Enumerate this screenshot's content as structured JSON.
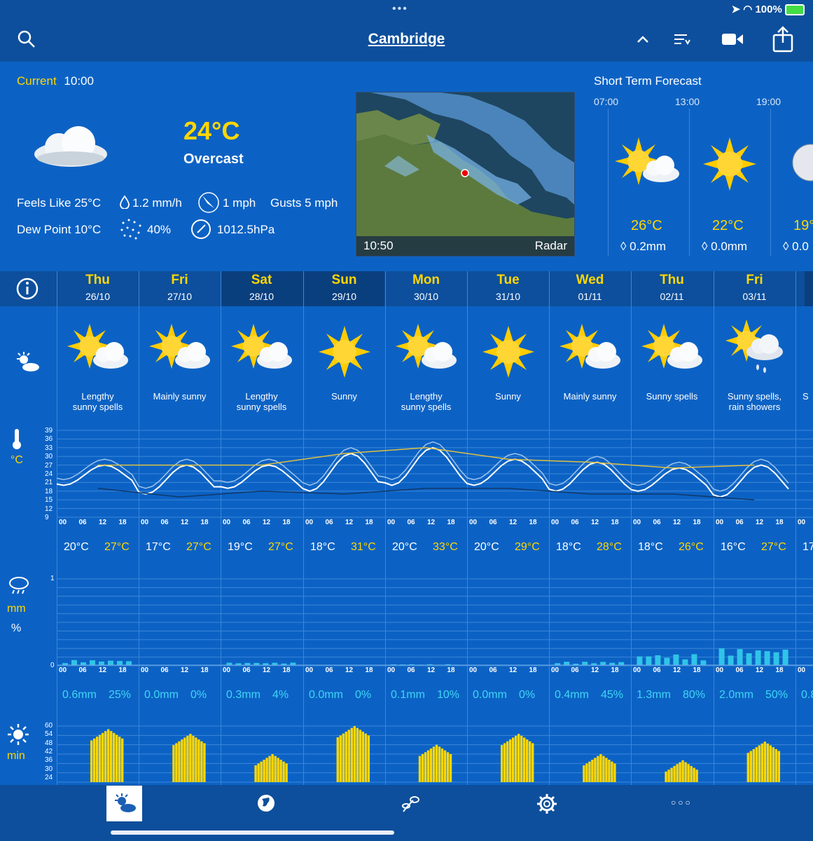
{
  "status": {
    "top_dots": "•••",
    "battery": "100%"
  },
  "header": {
    "title": "Cambridge"
  },
  "current": {
    "label": "Current",
    "time": "10:00",
    "temperature": "24°C",
    "condition": "Overcast",
    "feels_like": "Feels Like 25°C",
    "precip_rate": "1.2 mm/h",
    "wind": "1 mph",
    "gusts": "Gusts 5 mph",
    "dew_point": "Dew Point 10°C",
    "humidity": "40%",
    "pressure": "1012.5hPa"
  },
  "radar": {
    "time": "10:50",
    "label": "Radar"
  },
  "short_term": {
    "title": "Short Term Forecast",
    "slots": [
      {
        "time": "07:00",
        "icon": "sun-cloud-icon",
        "temp": "26°C",
        "rain": "0.2mm"
      },
      {
        "time": "13:00",
        "icon": "sun-icon",
        "temp": "22°C",
        "rain": "0.0mm"
      },
      {
        "time": "19:00",
        "icon": "moon-icon",
        "temp": "19°",
        "rain": "0.0"
      }
    ]
  },
  "days": [
    {
      "name": "Thu",
      "date": "26/10",
      "desc1": "Lengthy",
      "desc2": "sunny spells",
      "icon": "sun-cloud-icon",
      "tmin": "20°C",
      "tmax": "27°C",
      "rain": "0.6mm",
      "prob": "25%",
      "sun": 58
    },
    {
      "name": "Fri",
      "date": "27/10",
      "desc1": "Mainly sunny",
      "desc2": "",
      "icon": "sun-cloud-icon",
      "tmin": "17°C",
      "tmax": "27°C",
      "rain": "0.0mm",
      "prob": "0%",
      "sun": 55
    },
    {
      "name": "Sat",
      "date": "28/10",
      "desc1": "Lengthy",
      "desc2": "sunny spells",
      "icon": "sun-cloud-icon",
      "tmin": "19°C",
      "tmax": "27°C",
      "rain": "0.3mm",
      "prob": "4%",
      "sun": 42
    },
    {
      "name": "Sun",
      "date": "29/10",
      "desc1": "Sunny",
      "desc2": "",
      "icon": "sun-icon",
      "tmin": "18°C",
      "tmax": "31°C",
      "rain": "0.0mm",
      "prob": "0%",
      "sun": 60
    },
    {
      "name": "Mon",
      "date": "30/10",
      "desc1": "Lengthy",
      "desc2": "sunny spells",
      "icon": "sun-cloud-icon",
      "tmin": "20°C",
      "tmax": "33°C",
      "rain": "0.1mm",
      "prob": "10%",
      "sun": 48
    },
    {
      "name": "Tue",
      "date": "31/10",
      "desc1": "Sunny",
      "desc2": "",
      "icon": "sun-icon",
      "tmin": "20°C",
      "tmax": "29°C",
      "rain": "0.0mm",
      "prob": "0%",
      "sun": 55
    },
    {
      "name": "Wed",
      "date": "01/11",
      "desc1": "Mainly sunny",
      "desc2": "",
      "icon": "sun-cloud-icon",
      "tmin": "18°C",
      "tmax": "28°C",
      "rain": "0.4mm",
      "prob": "45%",
      "sun": 42
    },
    {
      "name": "Thu",
      "date": "02/11",
      "desc1": "Sunny spells",
      "desc2": "",
      "icon": "sun-cloud-icon",
      "tmin": "18°C",
      "tmax": "26°C",
      "rain": "1.3mm",
      "prob": "80%",
      "sun": 38
    },
    {
      "name": "Fri",
      "date": "03/11",
      "desc1": "Sunny spells,",
      "desc2": "rain showers",
      "icon": "sun-rain-icon",
      "tmin": "16°C",
      "tmax": "27°C",
      "rain": "2.0mm",
      "prob": "50%",
      "sun": 50
    }
  ],
  "partial_day": {
    "tmin": "17",
    "rain": "0.8",
    "desc": "S"
  },
  "axes": {
    "temp_unit": "°C",
    "temp_ticks": [
      "39",
      "36",
      "33",
      "30",
      "27",
      "24",
      "21",
      "18",
      "15",
      "12",
      "9"
    ],
    "hours": [
      "00",
      "06",
      "12",
      "18"
    ],
    "rain_unit_mm": "mm",
    "rain_unit_pct": "%",
    "rain_ticks": [
      "1",
      "0"
    ],
    "sun_unit": "min",
    "sun_ticks": [
      "60",
      "54",
      "48",
      "42",
      "36",
      "30",
      "24"
    ]
  },
  "colors": {
    "background": "#0c62c4",
    "header": "#0d4f9c",
    "accent": "#ffd700",
    "rain": "#3fd6f5"
  },
  "nav": [
    "weather-icon",
    "globe-icon",
    "plant-icon",
    "settings-icon",
    "more-icon"
  ],
  "chart_data": [
    {
      "type": "line",
      "title": "",
      "ylabel": "°C",
      "ylim": [
        9,
        39
      ],
      "x": [
        "26/10",
        "27/10",
        "28/10",
        "29/10",
        "30/10",
        "31/10",
        "01/11",
        "02/11",
        "03/11"
      ],
      "series": [
        {
          "values_min": [
            20,
            17,
            19,
            18,
            20,
            20,
            18,
            18,
            16
          ],
          "values_max": [
            27,
            27,
            27,
            31,
            33,
            29,
            28,
            26,
            27
          ]
        }
      ]
    },
    {
      "type": "bar",
      "title": "",
      "ylabel": "min",
      "ylim": [
        24,
        60
      ],
      "categories": [
        "26/10",
        "27/10",
        "28/10",
        "29/10",
        "30/10",
        "31/10",
        "01/11",
        "02/11",
        "03/11"
      ],
      "values": [
        58,
        55,
        42,
        60,
        48,
        55,
        42,
        38,
        50
      ]
    }
  ]
}
